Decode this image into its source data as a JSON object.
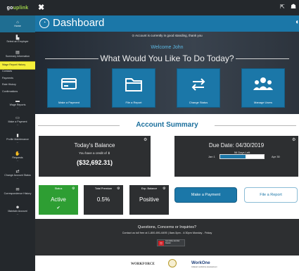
{
  "brand": {
    "part1": "go",
    "part2": "uplink"
  },
  "sidebar": {
    "home": "Home",
    "items": [
      {
        "label": "Select an Employer",
        "icon": "building-icon"
      },
      {
        "label": "Summary Information",
        "icon": "list-icon"
      },
      {
        "label": "Wage Report History",
        "highlighted": true
      },
      {
        "label": "Contacts"
      },
      {
        "label": "Payments"
      },
      {
        "label": "Rate History"
      },
      {
        "label": "Confirmations"
      },
      {
        "label": "Wage Reports",
        "icon": "folder-icon"
      },
      {
        "label": "Make a Payment",
        "icon": "card-icon"
      },
      {
        "label": "Profile Maintenance",
        "icon": "file-icon"
      },
      {
        "label": "Requests",
        "icon": "hand-icon"
      },
      {
        "label": "Change Account Status",
        "icon": "swap-icon"
      },
      {
        "label": "Correspondence History",
        "icon": "mail-icon"
      },
      {
        "label": "Maintain Account",
        "icon": "users-icon"
      }
    ]
  },
  "topbar": {
    "close": "✖",
    "exit_icon": "exit-icon",
    "user_icon": "user-icon"
  },
  "title": "Dashboard",
  "hero": {
    "notice": "⊙ Account is currently in good standing, thank you",
    "welcome": "Welcome John",
    "question": "What Would You Like To Do Today?",
    "tiles": [
      {
        "label": "Make a Payment",
        "icon": "card-icon"
      },
      {
        "label": "File a Report",
        "icon": "folder-icon"
      },
      {
        "label": "Change Status",
        "icon": "swap-icon"
      },
      {
        "label": "Manage Users",
        "icon": "users-icon"
      }
    ]
  },
  "summary": {
    "title": "Account Summary",
    "balance": {
      "title": "Today's Balance",
      "note": "You have a credit of ⬇",
      "amount": "($32,692.31)"
    },
    "due": {
      "title": "Due Date: 04/30/2019",
      "days_left": "56 Days Left",
      "start": "Jan 1",
      "end": "Apr 30",
      "progress": 0.58
    },
    "kpis": [
      {
        "label": "Status",
        "value": "Active",
        "check": "✔",
        "bg": "#2e9e33",
        "fg": "#ffffff"
      },
      {
        "label": "Total Premium",
        "value": "0.5%",
        "bg": "#2d2f31",
        "fg": "#ffffff"
      },
      {
        "label": "Exp. Balance",
        "value": "Positive",
        "bg": "#2d2f31",
        "fg": "#ffffff"
      }
    ],
    "buttons": {
      "pay": "Make a Payment",
      "report": "File a Report"
    }
  },
  "contact": {
    "question": "Questions, Concerns or Inquiries?",
    "info": "Contact us toll free at 1-800-891-6495 | 8am-5pm - 4:30pm Monday - Friday",
    "reader": "Get Adobe Acrobat Reader"
  },
  "footer": {
    "workforce": "WORKFORCE",
    "workone": "WorkOne",
    "workone_sub": "Indiana's workforce development"
  },
  "colors": {
    "accent": "#1b77a8",
    "dark": "#24282c",
    "panel": "#2d2f31",
    "active": "#2e9e33",
    "highlight": "#f5f03a"
  }
}
